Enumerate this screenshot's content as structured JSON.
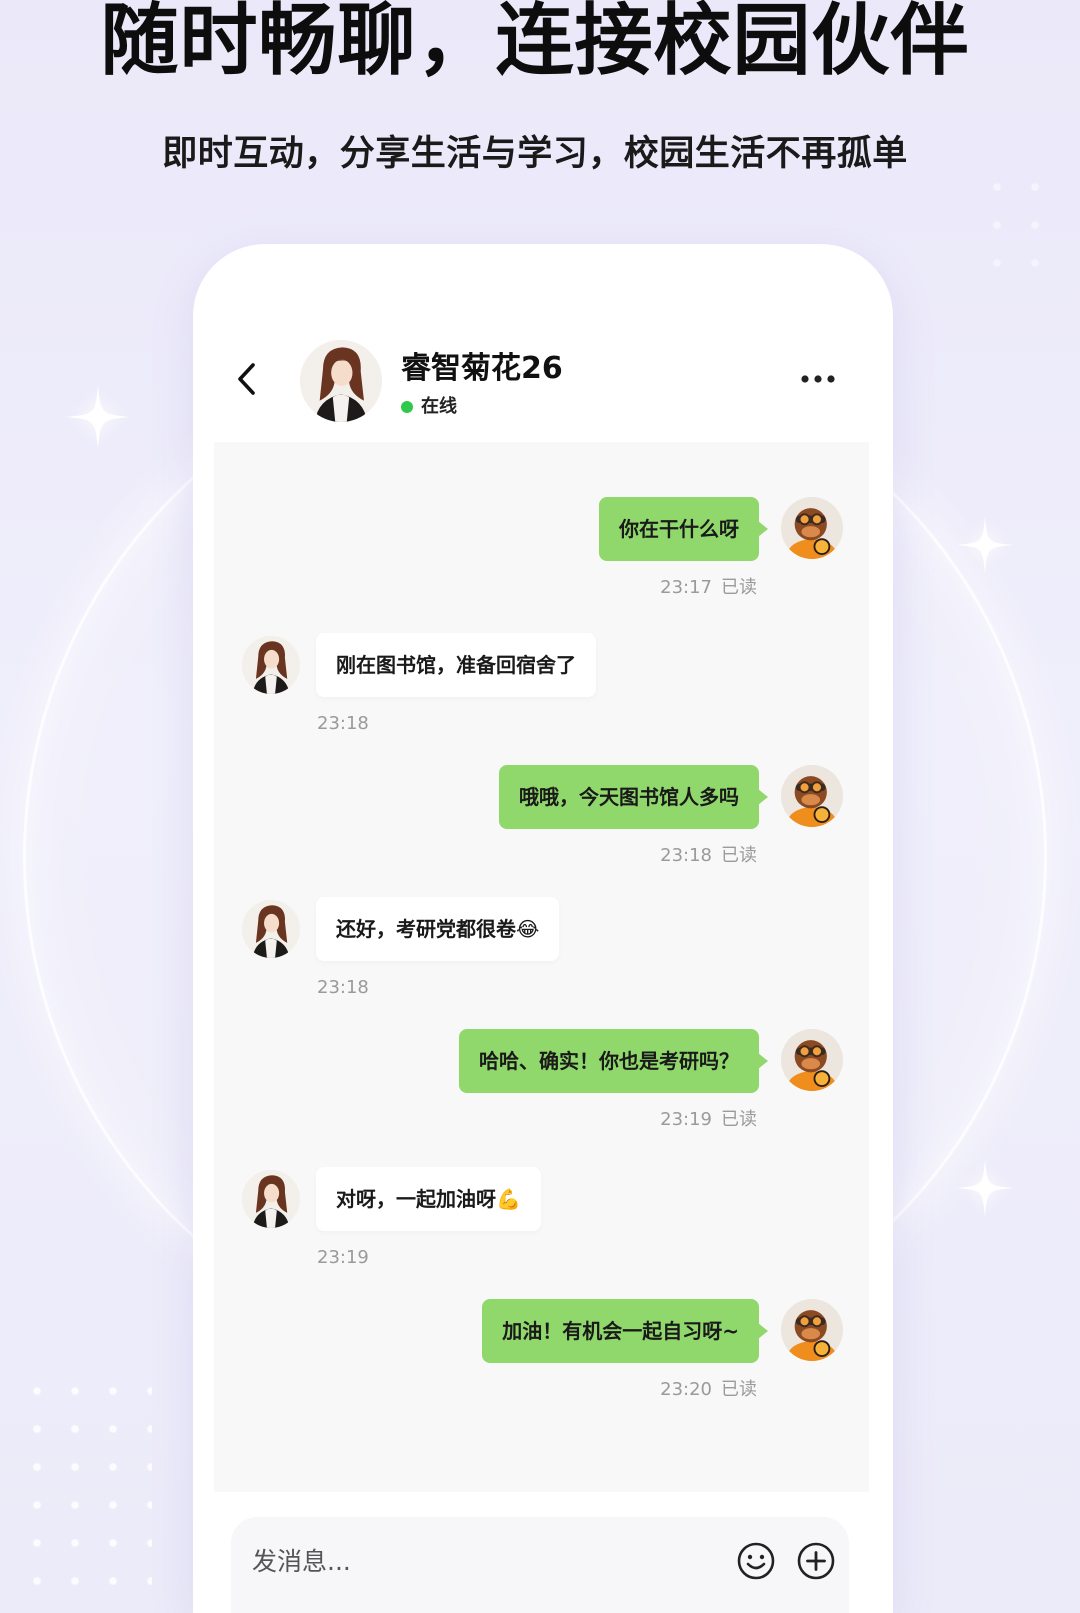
{
  "hero": {
    "title": "随时畅聊，连接校园伙伴",
    "subtitle": "即时互动，分享生活与学习，校园生活不再孤单"
  },
  "chat_header": {
    "contact_name": "睿智菊花26",
    "status": "在线"
  },
  "messages": [
    {
      "outgoing": true,
      "text": "你在干什么呀",
      "time": "23:17",
      "read": "已读"
    },
    {
      "outgoing": false,
      "text": "刚在图书馆，准备回宿舍了",
      "time": "23:18"
    },
    {
      "outgoing": true,
      "text": "哦哦，今天图书馆人多吗",
      "time": "23:18",
      "read": "已读"
    },
    {
      "outgoing": false,
      "text": "还好，考研党都很卷😂",
      "time": "23:18"
    },
    {
      "outgoing": true,
      "text": "哈哈、确实！你也是考研吗？",
      "time": "23:19",
      "read": "已读"
    },
    {
      "outgoing": false,
      "text": "对呀，一起加油呀💪",
      "time": "23:19"
    },
    {
      "outgoing": true,
      "text": "加油！有机会一起自习呀~",
      "time": "23:20",
      "read": "已读"
    }
  ],
  "composer": {
    "placeholder": "发消息..."
  },
  "icons": {
    "back": "chevron-left-icon",
    "more": "more-horizontal-icon",
    "emoji": "smile-icon",
    "add": "plus-circle-icon",
    "decoration": "sparkle-icon"
  },
  "colors": {
    "bubble_green": "#90d86c",
    "online_dot": "#2fc84a",
    "background": "#edecfa",
    "text_primary": "#111111",
    "text_muted": "#9a9a9a"
  }
}
